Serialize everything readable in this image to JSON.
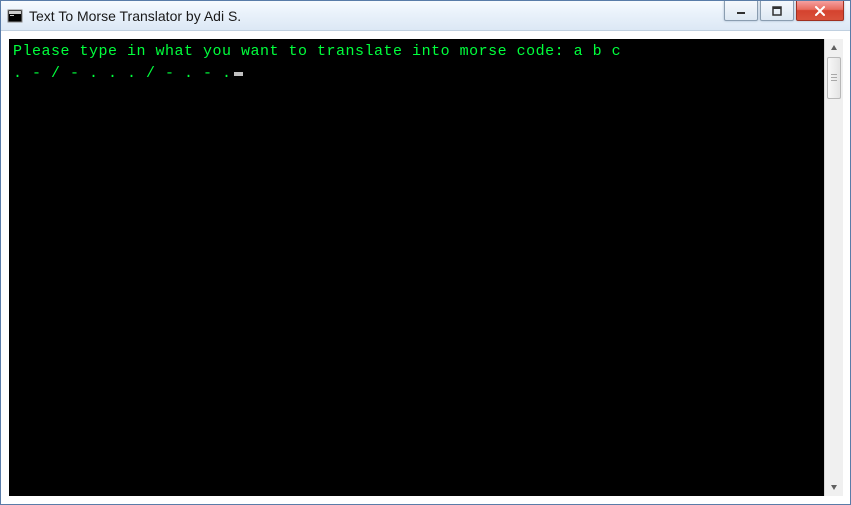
{
  "window": {
    "title": "Text To Morse Translator by Adi S."
  },
  "console": {
    "prompt": "Please type in what you want to translate into morse code: ",
    "input": "a b c",
    "blank1": "",
    "blank2": "",
    "output": ". - / - . . . / - . - ."
  }
}
